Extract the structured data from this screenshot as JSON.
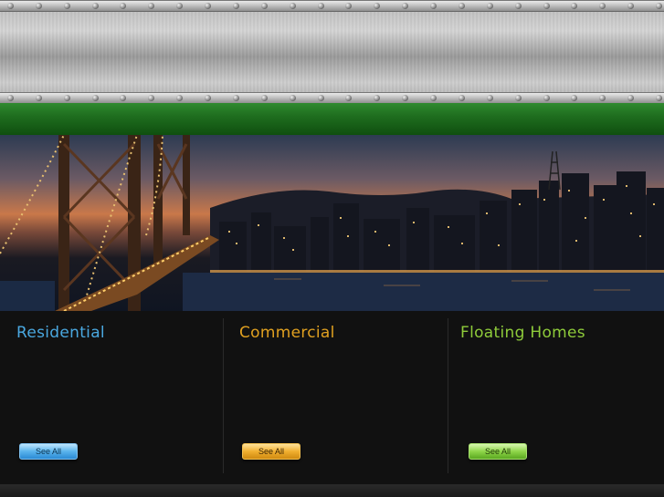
{
  "header": {
    "rivets_per_row": 24
  },
  "banner": {
    "image": "san-francisco-bay-bridge-night-skyline"
  },
  "columns": [
    {
      "title": "Residential",
      "title_color": "#4aa8e0",
      "button_label": "See All",
      "button_style": "blue"
    },
    {
      "title": "Commercial",
      "title_color": "#e0a020",
      "button_label": "See All",
      "button_style": "orange"
    },
    {
      "title": "Floating Homes",
      "title_color": "#8ecb3a",
      "button_label": "See All",
      "button_style": "green"
    }
  ]
}
